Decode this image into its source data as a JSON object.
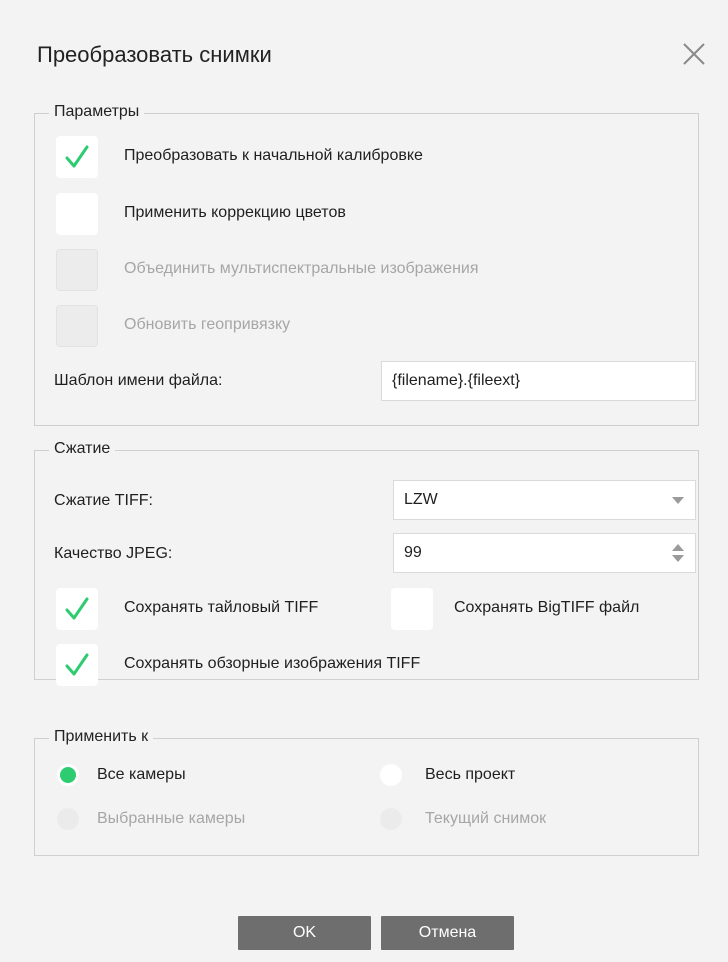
{
  "dialog": {
    "title": "Преобразовать снимки",
    "close_icon": "close-icon"
  },
  "parameters": {
    "legend": "Параметры",
    "options": [
      {
        "label": "Преобразовать к начальной калибровке",
        "checked": true,
        "enabled": true
      },
      {
        "label": "Применить коррекцию цветов",
        "checked": false,
        "enabled": true
      },
      {
        "label": "Объединить мультиспектральные изображения",
        "checked": false,
        "enabled": false
      },
      {
        "label": "Обновить геопривязку",
        "checked": false,
        "enabled": false
      }
    ],
    "filename_template": {
      "label": "Шаблон имени файла:",
      "value": "{filename}.{fileext}"
    }
  },
  "compression": {
    "legend": "Сжатие",
    "tiff": {
      "label": "Сжатие TIFF:",
      "value": "LZW"
    },
    "jpeg": {
      "label": "Качество JPEG:",
      "value": "99"
    },
    "tiled_tiff": {
      "label": "Сохранять тайловый TIFF",
      "checked": true
    },
    "bigtiff": {
      "label": "Сохранять BigTIFF файл",
      "checked": false
    },
    "overviews": {
      "label": "Сохранять обзорные изображения TIFF",
      "checked": true
    }
  },
  "apply_to": {
    "legend": "Применить к",
    "options": [
      {
        "label": "Все камеры",
        "selected": true,
        "enabled": true
      },
      {
        "label": "Весь проект",
        "selected": false,
        "enabled": true
      },
      {
        "label": "Выбранные камеры",
        "selected": false,
        "enabled": false
      },
      {
        "label": "Текущий снимок",
        "selected": false,
        "enabled": false
      }
    ]
  },
  "buttons": {
    "ok": "OK",
    "cancel": "Отмена"
  },
  "colors": {
    "check_accent": "#2ecc71",
    "button_bg": "#6e6e6e",
    "dialog_bg": "#f3f3f3"
  }
}
